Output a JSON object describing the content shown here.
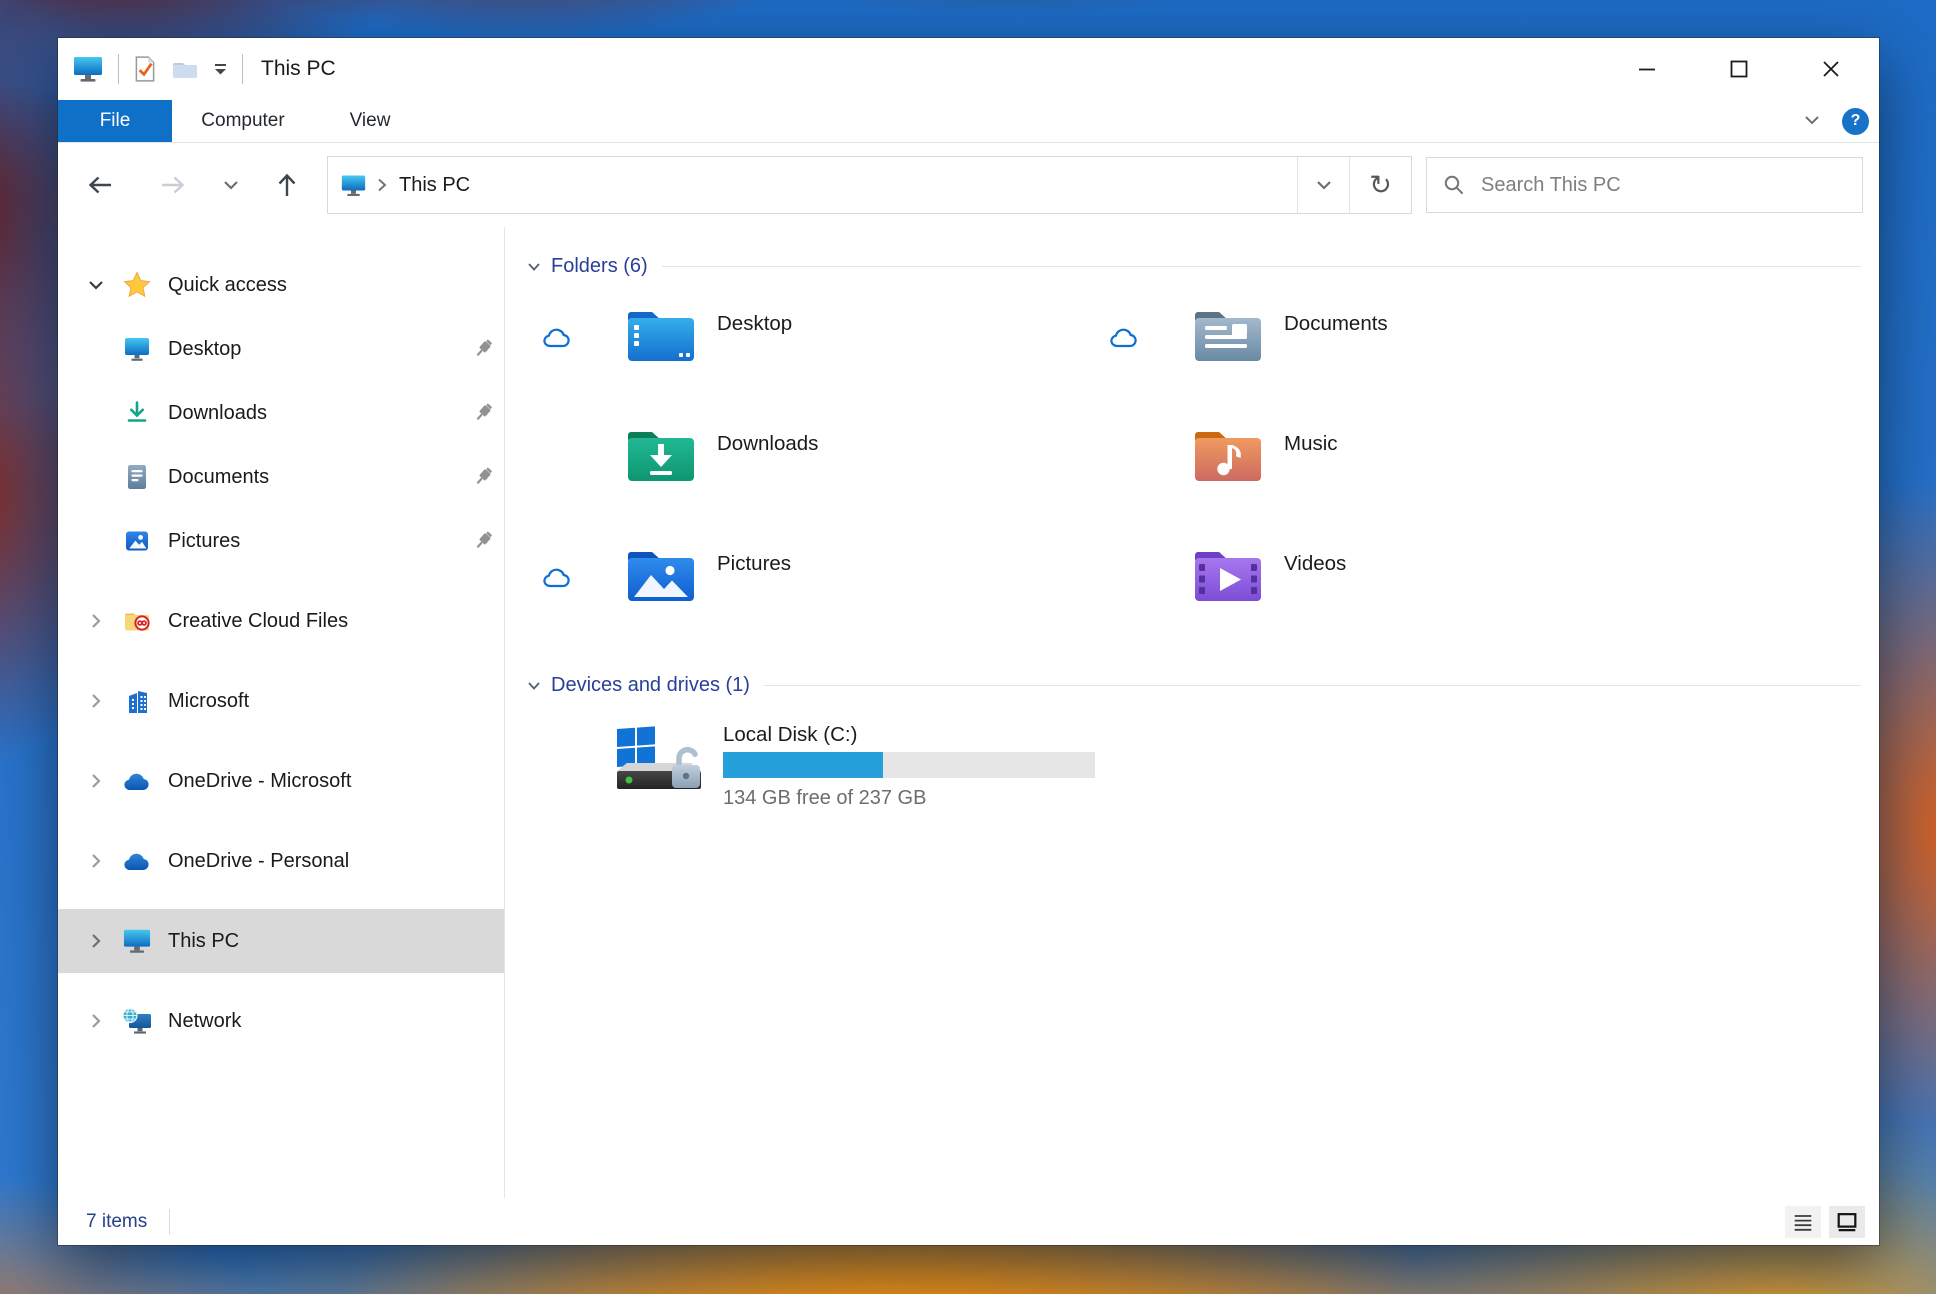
{
  "window": {
    "title": "This PC"
  },
  "ribbon": {
    "tabs": [
      {
        "label": "File",
        "active": true
      },
      {
        "label": "Computer",
        "active": false
      },
      {
        "label": "View",
        "active": false
      }
    ]
  },
  "toolbar": {
    "address": {
      "location": "This PC"
    },
    "search": {
      "placeholder": "Search This PC"
    }
  },
  "sidebar": {
    "items": [
      {
        "label": "Quick access",
        "expanded": true
      },
      {
        "label": "Desktop",
        "pinned": true
      },
      {
        "label": "Downloads",
        "pinned": true
      },
      {
        "label": "Documents",
        "pinned": true
      },
      {
        "label": "Pictures",
        "pinned": true
      },
      {
        "label": "Creative Cloud Files"
      },
      {
        "label": "Microsoft"
      },
      {
        "label": "OneDrive - Microsoft"
      },
      {
        "label": "OneDrive - Personal"
      },
      {
        "label": "This PC",
        "selected": true
      },
      {
        "label": "Network"
      }
    ]
  },
  "main": {
    "groups": [
      {
        "label": "Folders (6)"
      },
      {
        "label": "Devices and drives (1)"
      }
    ],
    "folders": [
      {
        "name": "Desktop",
        "cloud": true
      },
      {
        "name": "Documents",
        "cloud": true
      },
      {
        "name": "Downloads",
        "cloud": false
      },
      {
        "name": "Music",
        "cloud": false
      },
      {
        "name": "Pictures",
        "cloud": true
      },
      {
        "name": "Videos",
        "cloud": false
      }
    ],
    "drives": [
      {
        "name": "Local Disk (C:)",
        "used_percent": 43,
        "free_text": "134 GB free of 237 GB"
      }
    ]
  },
  "statusbar": {
    "items_count": "7 items"
  },
  "icons": {
    "refresh": "↻",
    "names": [
      "this-pc-icon",
      "properties-icon",
      "new-folder-icon",
      "customize-qat-icon",
      "back-icon",
      "forward-icon",
      "recent-locations-icon",
      "up-icon",
      "search-icon",
      "star-icon",
      "pin-icon",
      "cloud-status-icon",
      "onedrive-icon",
      "network-icon",
      "building-icon",
      "help-icon"
    ]
  },
  "colors": {
    "file_tab": "#0f70c8",
    "group_header": "#28409a",
    "capacity_fill": "#26a0da",
    "capacity_track": "#e6e6e6",
    "selection": "#d9d9d9",
    "cloud_outline": "#0c6ed6",
    "status_text": "#26408c"
  }
}
